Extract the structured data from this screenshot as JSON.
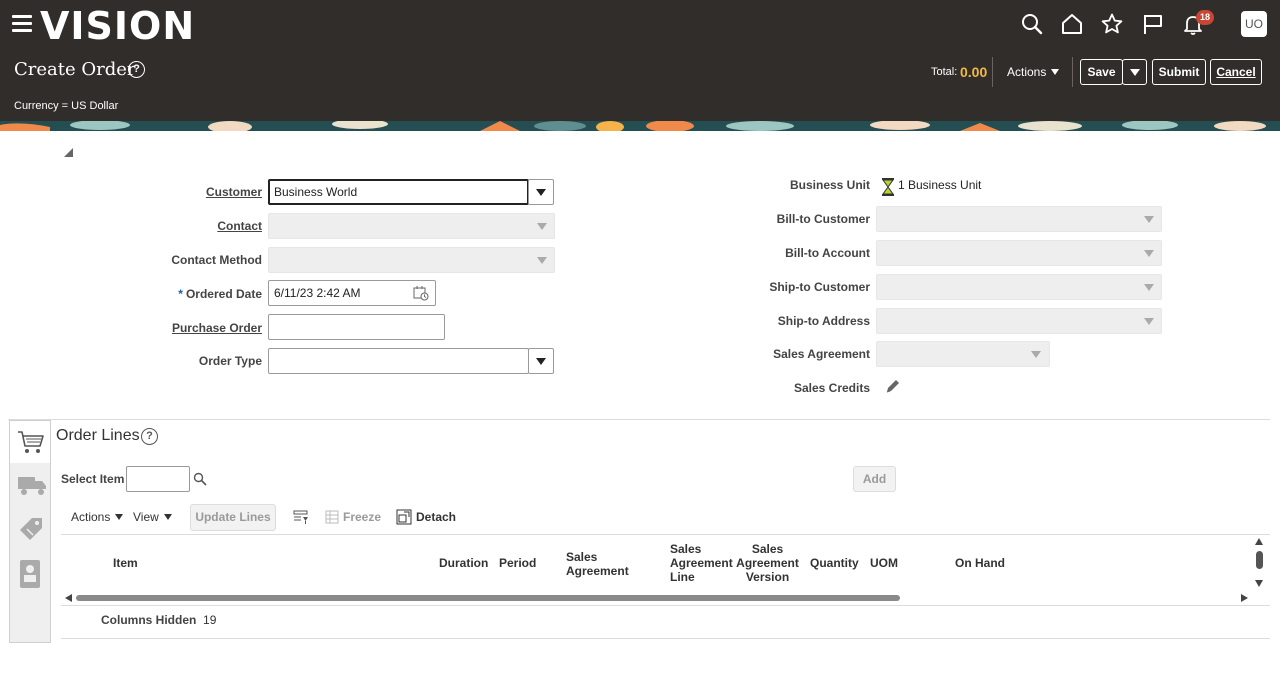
{
  "header": {
    "logo": "vision",
    "page_title": "Create Order",
    "currency": "Currency = US Dollar",
    "total_label": "Total:",
    "total_value": "0.00",
    "actions_label": "Actions",
    "save_label": "Save",
    "submit_label": "Submit",
    "cancel_label": "Cancel",
    "notification_count": "18",
    "user_initials": "UO",
    "accent_color": "#f4b942"
  },
  "form": {
    "customer_label": "Customer",
    "customer_value": "Business World",
    "contact_label": "Contact",
    "contact_method_label": "Contact Method",
    "ordered_date_label": "Ordered Date",
    "ordered_date_value": "6/11/23 2:42 AM",
    "purchase_order_label": "Purchase Order",
    "order_type_label": "Order Type",
    "business_unit_label": "Business Unit",
    "business_unit_value": "1 Business Unit",
    "bill_to_customer_label": "Bill-to Customer",
    "bill_to_account_label": "Bill-to Account",
    "ship_to_customer_label": "Ship-to Customer",
    "ship_to_address_label": "Ship-to Address",
    "sales_agreement_label": "Sales Agreement",
    "sales_credits_label": "Sales Credits"
  },
  "order_lines": {
    "title": "Order Lines",
    "select_item_label": "Select Item",
    "add_label": "Add",
    "actions_label": "Actions",
    "view_label": "View",
    "update_lines_label": "Update Lines",
    "freeze_label": "Freeze",
    "detach_label": "Detach",
    "columns": {
      "item": "Item",
      "duration": "Duration",
      "period": "Period",
      "sales_agreement": "Sales Agreement",
      "sales_agreement_line": "Sales Agreement Line",
      "sales_agreement_version": "Sales Agreement Version",
      "quantity": "Quantity",
      "uom": "UOM",
      "on_hand": "On Hand"
    },
    "columns_hidden_label": "Columns Hidden",
    "columns_hidden_count": "19"
  }
}
